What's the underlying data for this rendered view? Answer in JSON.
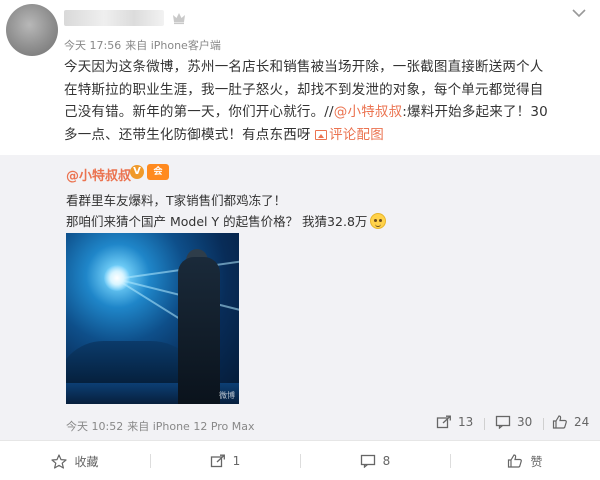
{
  "post": {
    "time": "今天 17:56",
    "source": "来自 iPhone客户端",
    "text_lines": [
      "今天因为这条微博，苏州一名店长和销售被当场开除，一张截图直接断送两个人",
      "在特斯拉的职业生涯，我一肚子怒火，却找不到发泄的对象，每个单元都觉得自",
      "己没有错。新年的第一天，你们开心就行。//"
    ],
    "mention": "@小特叔叔",
    "after_mention": ":爆料开始多起来了！30",
    "line4_start": "多一点、还带生化防御模式！有点东西呀",
    "comment_pic_label": "评论配图"
  },
  "repost": {
    "author": "@小特叔叔",
    "v_badge": "V",
    "member_badge": "会",
    "line1": "看群里车友爆料，T家销售们都鸡冻了！",
    "line2": "那咱们来猜个国产 Model Y 的起售价格？ 我猜32.8万",
    "photo_watermark": "微博",
    "time": "今天 10:52",
    "source": "来自 iPhone 12 Pro Max",
    "repost_count": "13",
    "comment_count": "30",
    "like_count": "24"
  },
  "actions": {
    "favorite": "收藏",
    "repost": "1",
    "comment": "8",
    "like": "赞"
  },
  "colors": {
    "accent": "#eb7350",
    "repost_bg": "#f2f2f5"
  }
}
